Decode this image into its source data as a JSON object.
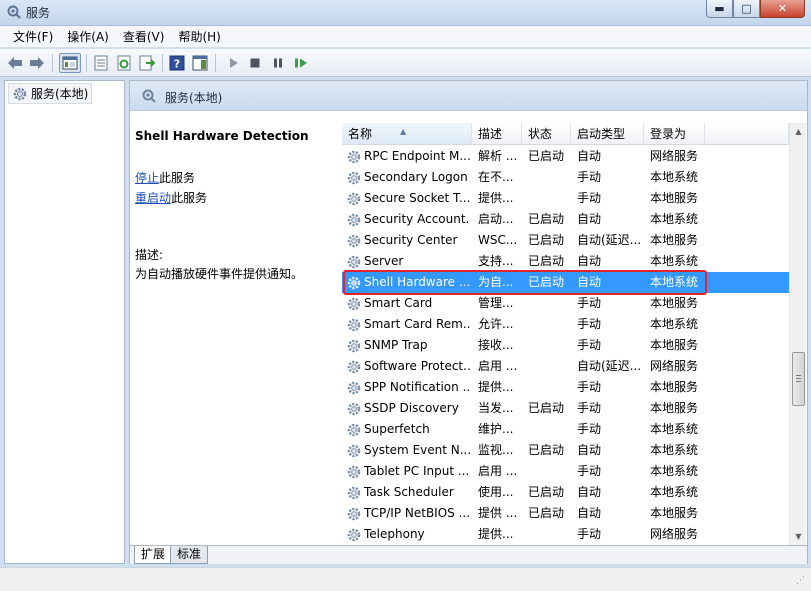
{
  "window": {
    "title": "服务",
    "min_glyph": "▬",
    "max_glyph": "□",
    "close_glyph": "✕"
  },
  "menu": [
    "文件(F)",
    "操作(A)",
    "查看(V)",
    "帮助(H)"
  ],
  "tree": {
    "item": "服务(本地)"
  },
  "panel": {
    "header": "服务(本地)",
    "service_name": "Shell Hardware Detection",
    "stop_link": "停止",
    "stop_suffix": "此服务",
    "restart_link": "重启动",
    "restart_suffix": "此服务",
    "desc_label": "描述:",
    "description": "为自动播放硬件事件提供通知。"
  },
  "columns": [
    "名称",
    "描述",
    "状态",
    "启动类型",
    "登录为"
  ],
  "rows": [
    {
      "name": "RPC Endpoint M...",
      "desc": "解析 ...",
      "status": "已启动",
      "startup": "自动",
      "logon": "网络服务"
    },
    {
      "name": "Secondary Logon",
      "desc": "在不...",
      "status": "",
      "startup": "手动",
      "logon": "本地系统"
    },
    {
      "name": "Secure Socket T...",
      "desc": "提供...",
      "status": "",
      "startup": "手动",
      "logon": "本地服务"
    },
    {
      "name": "Security Account...",
      "desc": "启动...",
      "status": "已启动",
      "startup": "自动",
      "logon": "本地系统"
    },
    {
      "name": "Security Center",
      "desc": "WSC...",
      "status": "已启动",
      "startup": "自动(延迟...",
      "logon": "本地服务"
    },
    {
      "name": "Server",
      "desc": "支持...",
      "status": "已启动",
      "startup": "自动",
      "logon": "本地系统"
    },
    {
      "name": "Shell Hardware ...",
      "desc": "为自...",
      "status": "已启动",
      "startup": "自动",
      "logon": "本地系统",
      "selected": true
    },
    {
      "name": "Smart Card",
      "desc": "管理...",
      "status": "",
      "startup": "手动",
      "logon": "本地服务"
    },
    {
      "name": "Smart Card Rem...",
      "desc": "允许...",
      "status": "",
      "startup": "手动",
      "logon": "本地系统"
    },
    {
      "name": "SNMP Trap",
      "desc": "接收...",
      "status": "",
      "startup": "手动",
      "logon": "本地服务"
    },
    {
      "name": "Software Protect...",
      "desc": "启用 ...",
      "status": "",
      "startup": "自动(延迟...",
      "logon": "网络服务"
    },
    {
      "name": "SPP Notification ...",
      "desc": "提供...",
      "status": "",
      "startup": "手动",
      "logon": "本地服务"
    },
    {
      "name": "SSDP Discovery",
      "desc": "当发...",
      "status": "已启动",
      "startup": "手动",
      "logon": "本地服务"
    },
    {
      "name": "Superfetch",
      "desc": "维护...",
      "status": "",
      "startup": "手动",
      "logon": "本地系统"
    },
    {
      "name": "System Event N...",
      "desc": "监视...",
      "status": "已启动",
      "startup": "自动",
      "logon": "本地系统"
    },
    {
      "name": "Tablet PC Input ...",
      "desc": "启用 ...",
      "status": "",
      "startup": "手动",
      "logon": "本地系统"
    },
    {
      "name": "Task Scheduler",
      "desc": "使用...",
      "status": "已启动",
      "startup": "自动",
      "logon": "本地系统"
    },
    {
      "name": "TCP/IP NetBIOS ...",
      "desc": "提供 ...",
      "status": "已启动",
      "startup": "自动",
      "logon": "本地服务"
    },
    {
      "name": "Telephony",
      "desc": "提供...",
      "status": "",
      "startup": "手动",
      "logon": "网络服务"
    }
  ],
  "tabs": [
    "扩展",
    "标准"
  ],
  "icons": {
    "back": "back-arrow-icon",
    "forward": "forward-arrow-icon",
    "service": "gear-icon",
    "play": "play-icon",
    "stop": "stop-icon",
    "pause": "pause-icon",
    "resume": "resume-icon"
  },
  "colors": {
    "selection": "#3399ff",
    "highlight_outline": "#e3242b",
    "link": "#1d50b8"
  }
}
